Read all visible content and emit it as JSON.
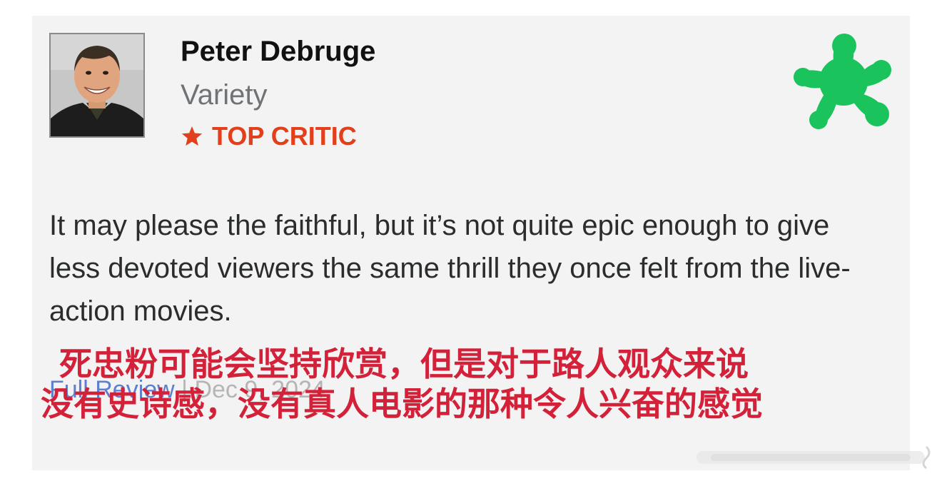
{
  "review": {
    "critic_name": "Peter Debruge",
    "publication": "Variety",
    "badge_label": "TOP CRITIC",
    "badge_icon": "star-icon",
    "rating_icon": "fresh-splat-icon",
    "quote": "It may please the faithful, but it’s not quite epic enough to give less devoted viewers the same thrill they once felt from the live-action movies.",
    "full_review_label": "Full Review",
    "separator": "|",
    "date": "Dec 9, 2024"
  },
  "annotation": {
    "line1": "死忠粉可能会坚持欣赏，但是对于路人观众来说",
    "line2": "没有史诗感，没有真人电影的那种令人兴奋的感觉"
  },
  "colors": {
    "card_background": "#f3f3f3",
    "top_critic": "#e2401c",
    "fresh_green": "#1ac35c",
    "link_blue": "#5d7fd0",
    "annotation_red": "#d4213a"
  }
}
